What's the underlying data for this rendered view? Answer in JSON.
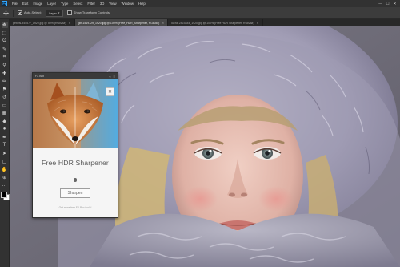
{
  "app": {
    "logo_text": "Ps"
  },
  "menu": {
    "items": [
      "File",
      "Edit",
      "Image",
      "Layer",
      "Type",
      "Select",
      "Filter",
      "3D",
      "View",
      "Window",
      "Help"
    ],
    "window_controls": [
      "—",
      "☐",
      "✕"
    ]
  },
  "options_bar": {
    "tool_icon": "move-tool-icon",
    "auto_select_label": "Auto-Select:",
    "auto_select_checked": true,
    "auto_select_value": "Layer",
    "show_transform_label": "Show Transform Controls",
    "show_transform_checked": false
  },
  "tabs": [
    {
      "label": "pexels-944577_1920.jpg @ 50% (RGB/8#)",
      "active": false
    },
    {
      "label": "girl-1519729_1920.jpg @ 100% (Free_HDR_Sharpener, RGB/8#)",
      "active": true
    },
    {
      "label": "lucha 2423484_1920.jpg @ 100% (Free HDR Sharpener, RGB/8#)",
      "active": false
    }
  ],
  "toolbar": {
    "tools": [
      {
        "name": "move-tool-icon",
        "glyph": "✥",
        "active": true
      },
      {
        "name": "marquee-tool-icon",
        "glyph": "⬚",
        "active": false
      },
      {
        "name": "lasso-tool-icon",
        "glyph": "ʘ",
        "active": false
      },
      {
        "name": "quick-select-tool-icon",
        "glyph": "✎",
        "active": false
      },
      {
        "name": "crop-tool-icon",
        "glyph": "⌗",
        "active": false
      },
      {
        "name": "eyedropper-tool-icon",
        "glyph": "⚲",
        "active": false
      },
      {
        "name": "healing-brush-tool-icon",
        "glyph": "✚",
        "active": false
      },
      {
        "name": "brush-tool-icon",
        "glyph": "✏",
        "active": false
      },
      {
        "name": "clone-stamp-tool-icon",
        "glyph": "⚑",
        "active": false
      },
      {
        "name": "history-brush-tool-icon",
        "glyph": "↺",
        "active": false
      },
      {
        "name": "eraser-tool-icon",
        "glyph": "▭",
        "active": false
      },
      {
        "name": "gradient-tool-icon",
        "glyph": "▦",
        "active": false
      },
      {
        "name": "blur-tool-icon",
        "glyph": "◆",
        "active": false
      },
      {
        "name": "dodge-tool-icon",
        "glyph": "●",
        "active": false
      },
      {
        "name": "pen-tool-icon",
        "glyph": "✒",
        "active": false
      },
      {
        "name": "type-tool-icon",
        "glyph": "T",
        "active": false
      },
      {
        "name": "path-select-tool-icon",
        "glyph": "➤",
        "active": false
      },
      {
        "name": "shape-tool-icon",
        "glyph": "▢",
        "active": false
      },
      {
        "name": "hand-tool-icon",
        "glyph": "✋",
        "active": false
      },
      {
        "name": "zoom-tool-icon",
        "glyph": "⊕",
        "active": false
      },
      {
        "name": "more-tools-icon",
        "glyph": "…",
        "active": false
      }
    ],
    "foreground_color": "#000000",
    "background_color": "#ffffff"
  },
  "panel": {
    "header_title": "FX Box",
    "header_controls": [
      "«",
      "≡"
    ],
    "close_glyph": "✕",
    "title": "Free HDR Sharpener",
    "slider_value": 0.5,
    "button_label": "Sharpen",
    "footer_text": "Get more free FX Box tools!"
  }
}
